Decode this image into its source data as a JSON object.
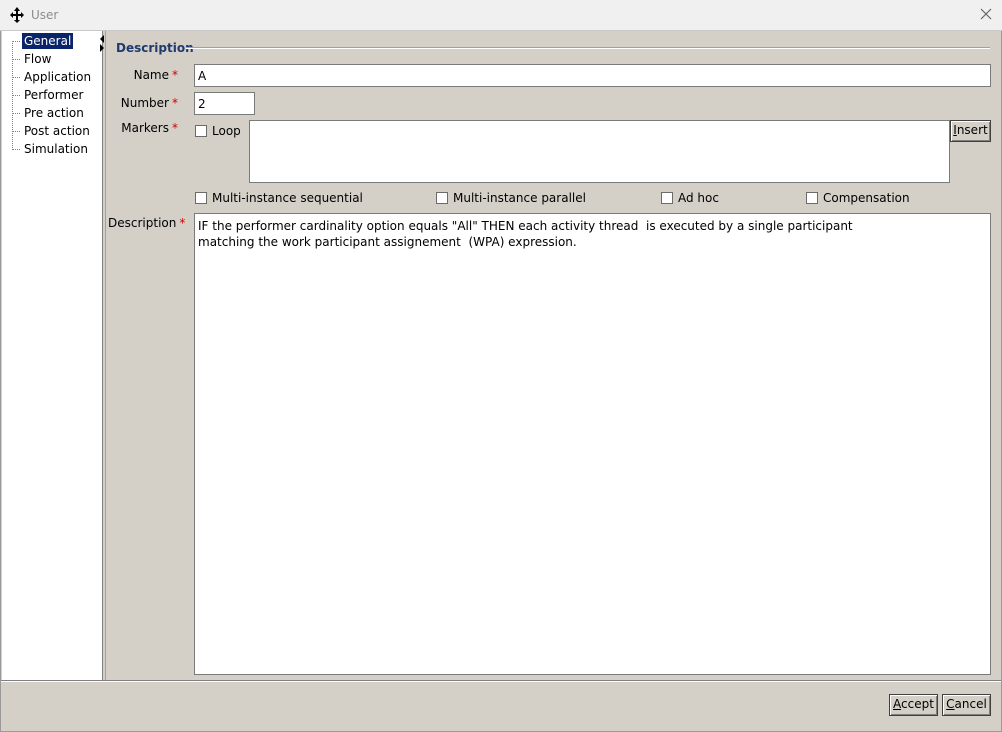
{
  "window": {
    "title": "User",
    "app_icon": "move-cross-icon",
    "close_icon": "close-icon"
  },
  "tree": {
    "items": [
      {
        "label": "General",
        "selected": true
      },
      {
        "label": "Flow"
      },
      {
        "label": "Application"
      },
      {
        "label": "Performer"
      },
      {
        "label": "Pre action"
      },
      {
        "label": "Post action"
      },
      {
        "label": "Simulation"
      }
    ]
  },
  "section": {
    "title": "Description"
  },
  "form": {
    "name_label": "Name",
    "name_value": "A",
    "number_label": "Number",
    "number_value": "2",
    "markers_label": "Markers",
    "loop_label": "Loop",
    "loop_checked": false,
    "insert_button": "Insert",
    "markers_text": "",
    "multi_seq_label": "Multi-instance sequential",
    "multi_par_label": "Multi-instance parallel",
    "adhoc_label": "Ad hoc",
    "compensation_label": "Compensation",
    "description_label": "Description",
    "description_value": "IF the performer cardinality option equals \"All\" THEN each activity thread  is executed by a single participant\nmatching the work participant assignement  (WPA) expression.",
    "required_mark": "*"
  },
  "buttons": {
    "accept": "Accept",
    "cancel": "Cancel"
  },
  "colors": {
    "background": "#d4d0c8",
    "selection": "#0a246a",
    "section_title": "#1f3a6f",
    "required": "#d00000"
  }
}
